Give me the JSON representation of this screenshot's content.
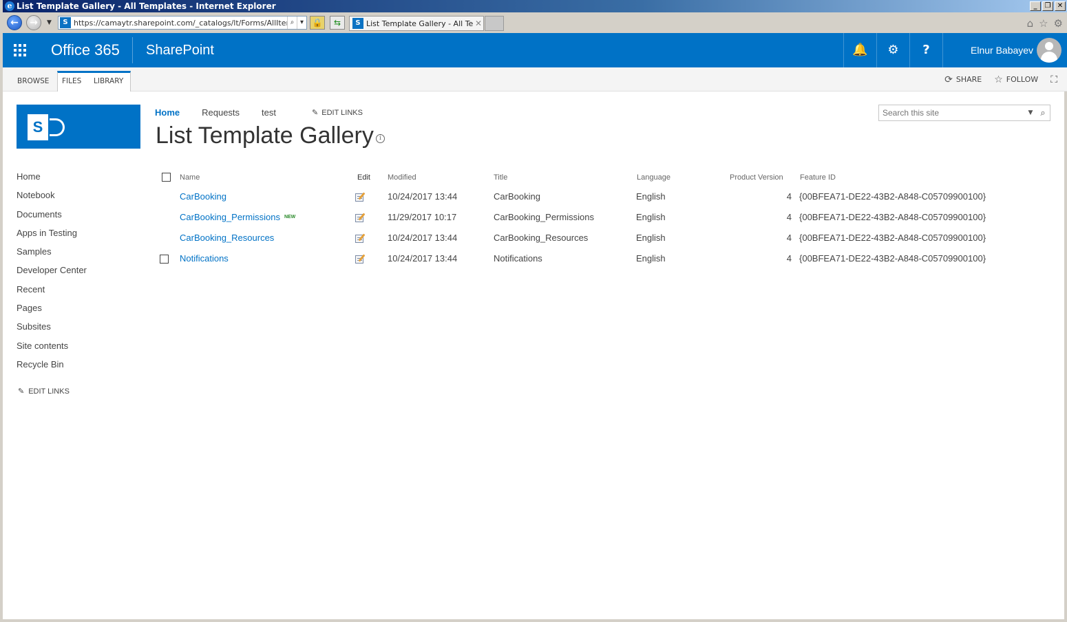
{
  "window": {
    "title": "List Template Gallery - All Templates - Internet Explorer"
  },
  "browser": {
    "url": "https://camaytr.sharepoint.com/_catalogs/lt/Forms/AllItems.as",
    "tab_title": "List Template Gallery - All Te...",
    "icons": [
      "home-icon",
      "favorites-star-icon",
      "tools-gear-icon"
    ]
  },
  "suite": {
    "brand": "Office 365",
    "app": "SharePoint",
    "user": "Elnur Babayev",
    "help": "?",
    "bg_color": "#0072c6"
  },
  "ribbon": {
    "tabs": [
      "BROWSE",
      "FILES",
      "LIBRARY"
    ],
    "share": "SHARE",
    "follow": "FOLLOW"
  },
  "topnav": {
    "items": [
      "Home",
      "Requests",
      "test"
    ],
    "edit_links": "EDIT LINKS"
  },
  "page": {
    "title": "List Template Gallery",
    "search_placeholder": "Search this site"
  },
  "quicklaunch": {
    "items": [
      "Home",
      "Notebook",
      "Documents",
      "Apps in Testing",
      "Samples",
      "Developer Center",
      "Recent",
      "Pages",
      "Subsites",
      "Site contents",
      "Recycle Bin"
    ],
    "edit_links": "EDIT LINKS"
  },
  "list": {
    "columns": [
      "Name",
      "Edit",
      "Modified",
      "Title",
      "Language",
      "Product Version",
      "Feature ID"
    ],
    "new_badge": "NEW",
    "rows": [
      {
        "name": "CarBooking",
        "modified": "10/24/2017 13:44",
        "title": "CarBooking",
        "language": "English",
        "version": "4",
        "feature_id": "{00BFEA71-DE22-43B2-A848-C05709900100}",
        "is_new": false,
        "checkbox": false
      },
      {
        "name": "CarBooking_Permissions",
        "modified": "11/29/2017 10:17",
        "title": "CarBooking_Permissions",
        "language": "English",
        "version": "4",
        "feature_id": "{00BFEA71-DE22-43B2-A848-C05709900100}",
        "is_new": true,
        "checkbox": false
      },
      {
        "name": "CarBooking_Resources",
        "modified": "10/24/2017 13:44",
        "title": "CarBooking_Resources",
        "language": "English",
        "version": "4",
        "feature_id": "{00BFEA71-DE22-43B2-A848-C05709900100}",
        "is_new": false,
        "checkbox": false
      },
      {
        "name": "Notifications",
        "modified": "10/24/2017 13:44",
        "title": "Notifications",
        "language": "English",
        "version": "4",
        "feature_id": "{00BFEA71-DE22-43B2-A848-C05709900100}",
        "is_new": false,
        "checkbox": true
      }
    ]
  }
}
